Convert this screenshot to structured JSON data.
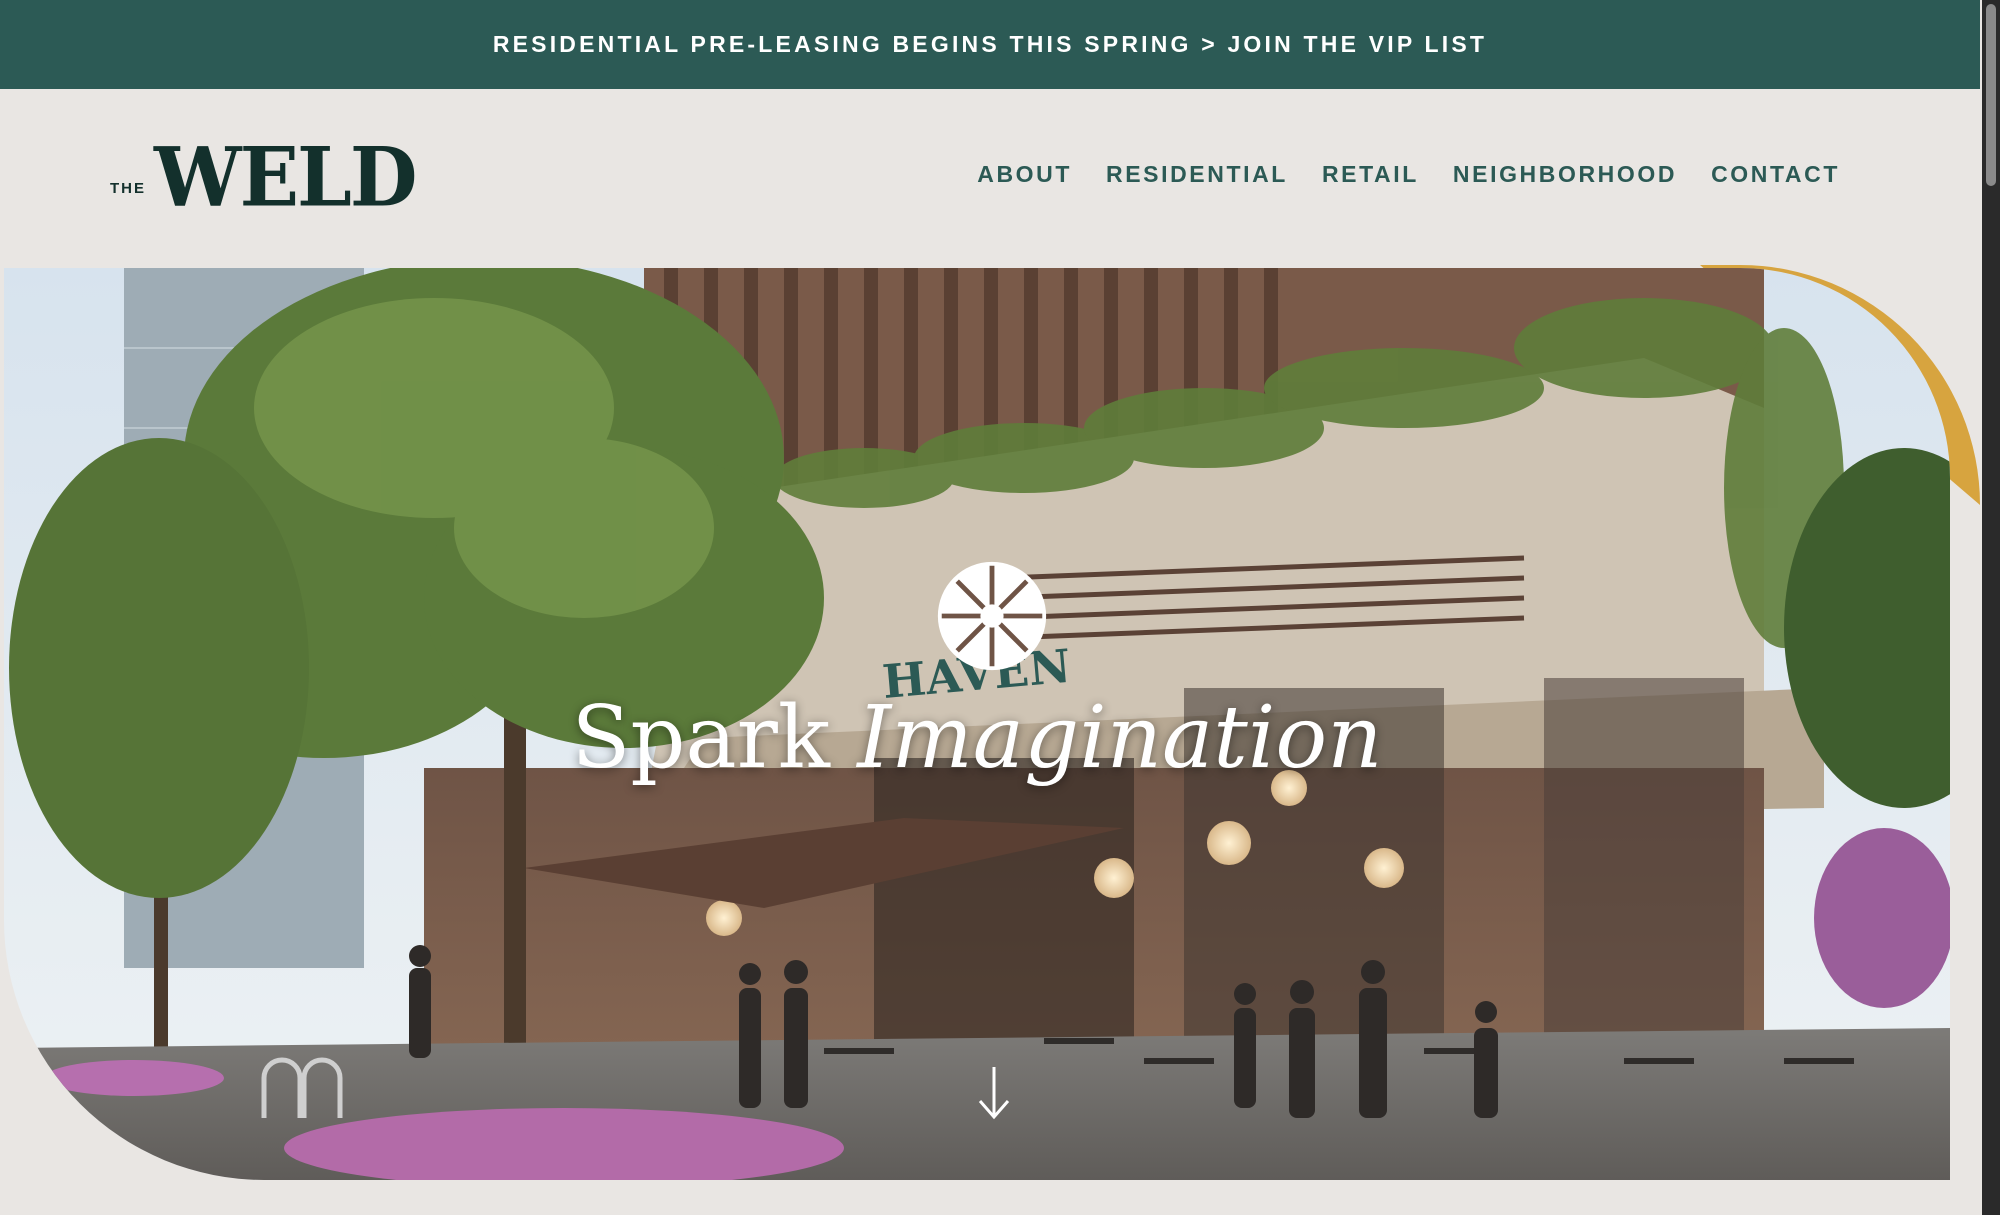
{
  "announcement": {
    "text": "RESIDENTIAL PRE-LEASING BEGINS THIS SPRING > JOIN THE VIP LIST"
  },
  "brand": {
    "prefix": "THE",
    "name": "WELD"
  },
  "nav": {
    "items": [
      {
        "label": "ABOUT"
      },
      {
        "label": "RESIDENTIAL"
      },
      {
        "label": "RETAIL"
      },
      {
        "label": "NEIGHBORHOOD"
      },
      {
        "label": "CONTACT"
      }
    ]
  },
  "hero": {
    "title_regular": "Spark",
    "title_italic": "Imagination",
    "building_sign": "HAVEN",
    "scroll_icon": "arrow-down-icon",
    "emblem_icon": "sunburst-icon"
  },
  "colors": {
    "brand_green": "#2c5a55",
    "brand_dark": "#13302c",
    "gold": "#d7a43f",
    "background": "#e9e6e3"
  }
}
